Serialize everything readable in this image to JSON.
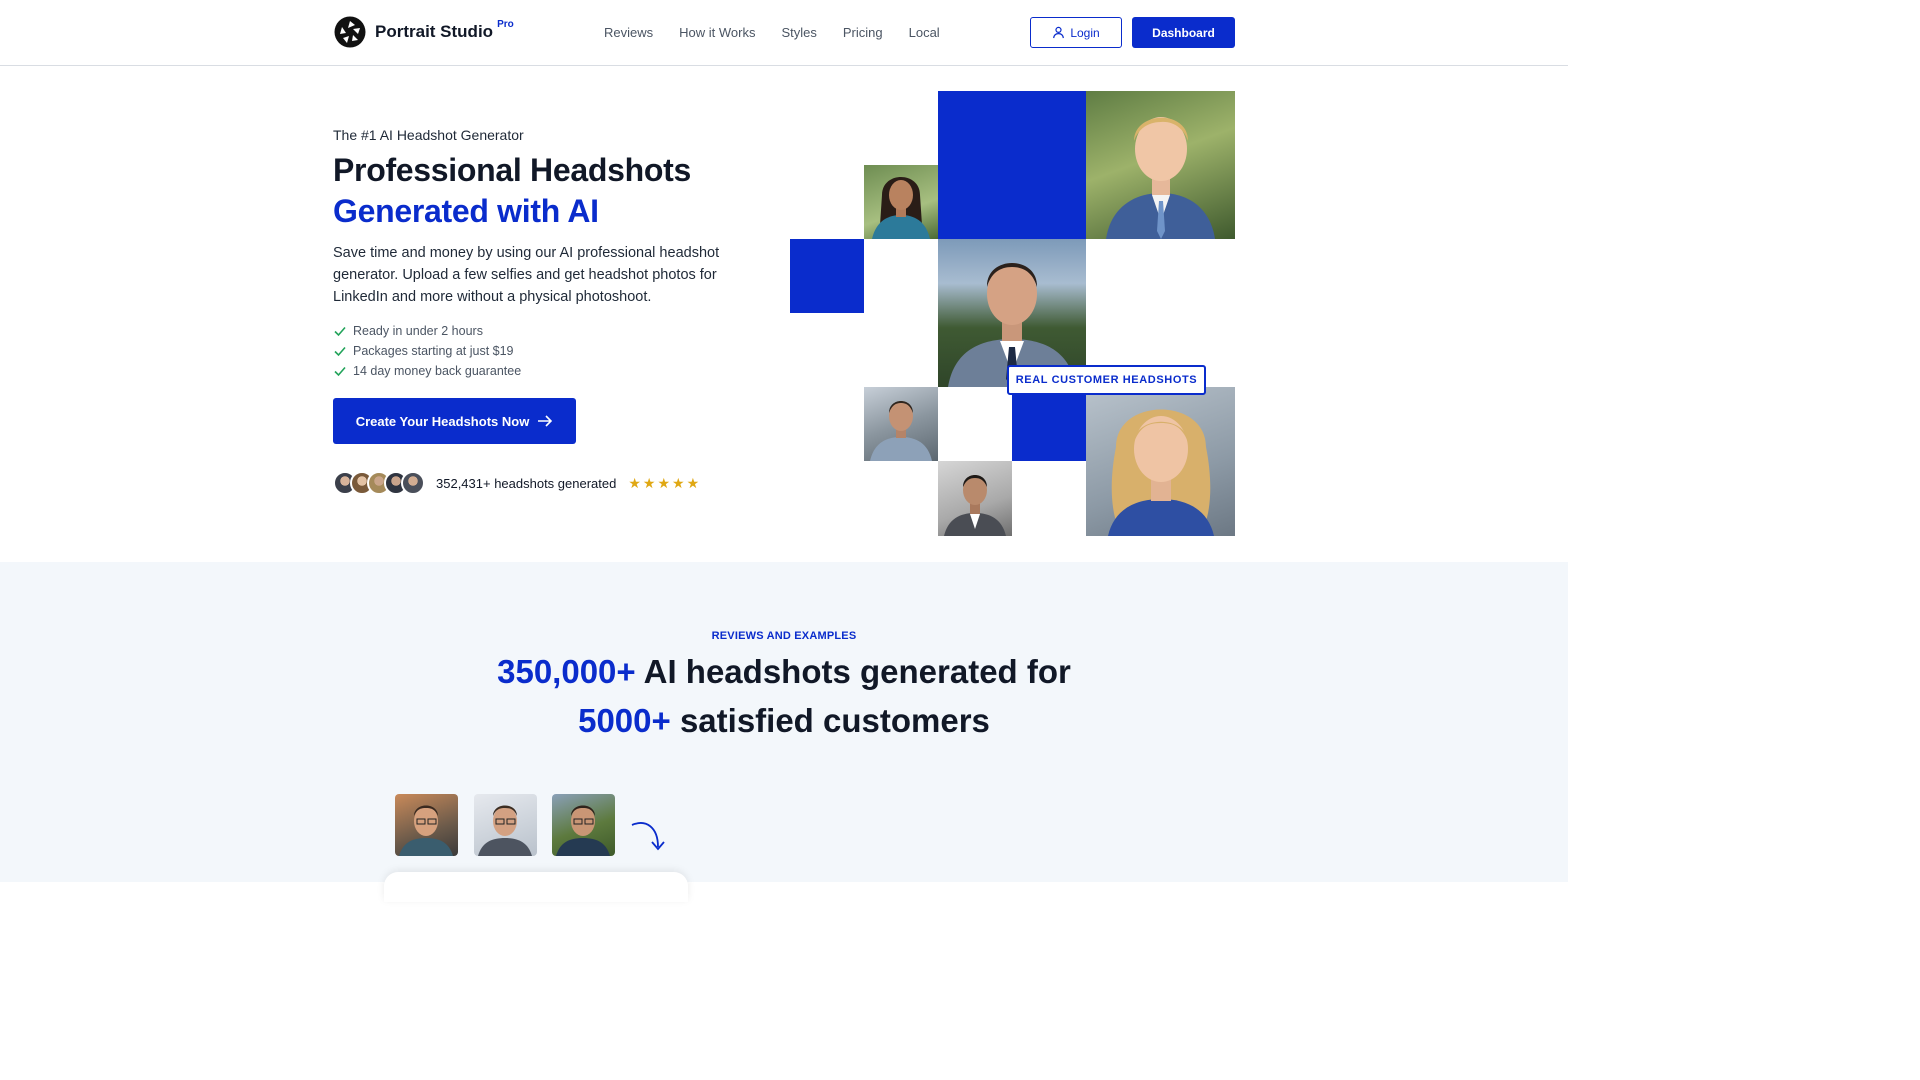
{
  "header": {
    "brand": "Portrait Studio",
    "brand_badge": "Pro",
    "nav": [
      "Reviews",
      "How it Works",
      "Styles",
      "Pricing",
      "Local"
    ],
    "login_label": "Login",
    "dashboard_label": "Dashboard"
  },
  "hero": {
    "eyebrow": "The #1 AI Headshot Generator",
    "title_line1": "Professional Headshots",
    "title_line2": "Generated with AI",
    "description": "Save time and money by using our AI professional headshot generator. Upload a few selfies and get headshot photos for LinkedIn and more without a physical photoshoot.",
    "checks": [
      "Ready in under 2 hours",
      "Packages starting at just $19",
      "14 day money back guarantee"
    ],
    "cta_label": "Create Your Headshots Now",
    "proof_text": "352,431+ headshots generated",
    "stars": "★★★★★",
    "rating": 5
  },
  "mosaic": {
    "badge": "REAL CUSTOMER HEADSHOTS"
  },
  "reviews": {
    "eyebrow": "REVIEWS AND EXAMPLES",
    "title_accent1": "350,000+",
    "title_text1": " AI headshots generated for",
    "title_accent2": "5000+",
    "title_text2": " satisfied customers"
  },
  "colors": {
    "brand": "#0a2ccc",
    "check": "#22a35a",
    "star": "#e0a814",
    "section_bg": "#f3f7fb"
  },
  "icons": {
    "logo": "aperture-logo-icon",
    "login": "user-icon",
    "cta": "arrow-right-icon",
    "check": "check-icon",
    "selfie_arrow": "curved-arrow-icon"
  }
}
